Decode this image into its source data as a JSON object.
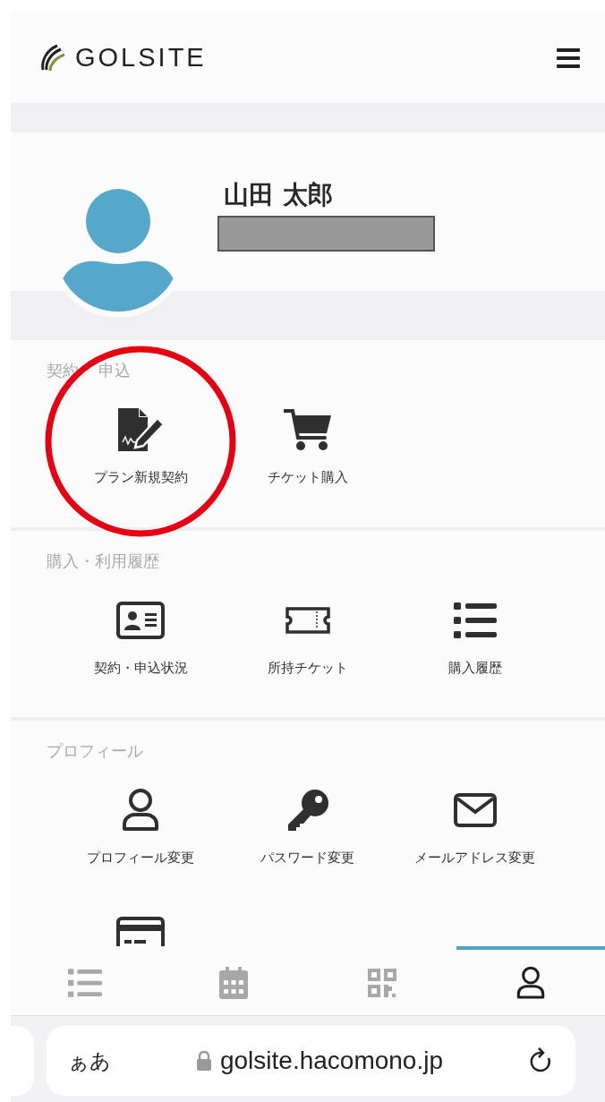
{
  "header": {
    "logo_text": "GOLSITE"
  },
  "profile": {
    "name": "山田 太郎"
  },
  "sections": [
    {
      "title_parts": [
        "契約",
        "申込"
      ],
      "items": [
        {
          "kind": "contract",
          "label": "プラン新規契約",
          "highlighted": true
        },
        {
          "kind": "cart",
          "label": "チケット購入",
          "highlighted": false
        }
      ]
    },
    {
      "title_parts": [
        "購入・利用履歴"
      ],
      "items": [
        {
          "kind": "idcard",
          "label": "契約・申込状況",
          "highlighted": false
        },
        {
          "kind": "ticket",
          "label": "所持チケット",
          "highlighted": false
        },
        {
          "kind": "list",
          "label": "購入履歴",
          "highlighted": false
        }
      ]
    },
    {
      "title_parts": [
        "プロフィール"
      ],
      "items": [
        {
          "kind": "user",
          "label": "プロフィール変更",
          "highlighted": false
        },
        {
          "kind": "key",
          "label": "パスワード変更",
          "highlighted": false
        },
        {
          "kind": "mail",
          "label": "メールアドレス変更",
          "highlighted": false
        },
        {
          "kind": "card",
          "highlighted": false
        }
      ]
    }
  ],
  "bottom_nav": [
    {
      "kind": "list",
      "selected": false
    },
    {
      "kind": "calendar",
      "selected": false
    },
    {
      "kind": "qr",
      "selected": false
    },
    {
      "kind": "user",
      "selected": true
    }
  ],
  "browser_bar": {
    "text_size": "ぁあ",
    "url": "golsite.hacomono.jp"
  }
}
